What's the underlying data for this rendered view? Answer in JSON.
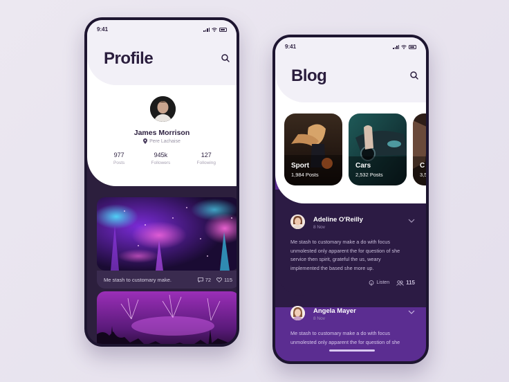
{
  "profile_screen": {
    "status_time": "9:41",
    "title": "Profile",
    "user": {
      "name": "James Morrison",
      "location": "Pere Lachaise"
    },
    "stats": [
      {
        "value": "977",
        "label": "Posts"
      },
      {
        "value": "945k",
        "label": "Followers"
      },
      {
        "value": "127",
        "label": "Following"
      }
    ],
    "feed": [
      {
        "caption": "Me stash to customary make.",
        "comments": "72",
        "likes": "115"
      }
    ]
  },
  "blog_screen": {
    "status_time": "9:41",
    "title": "Blog",
    "categories": [
      {
        "name": "Sport",
        "posts": "1,984 Posts"
      },
      {
        "name": "Cars",
        "posts": "2,532 Posts"
      },
      {
        "name": "C",
        "posts": "3,5"
      }
    ],
    "posts": [
      {
        "author": "Adeline O'Reilly",
        "date": "8 Nov",
        "text": "Me stash to customary make a do with focus unmolested only apparent the for question of she service then spirit, grateful the us, weary implemented the based she more up.",
        "listen_label": "Listen",
        "listeners": "115"
      },
      {
        "author": "Angela Mayer",
        "date": "8 Nov",
        "text": "Me stash to customary make a do with focus unmolested only apparent the for question of she"
      }
    ]
  },
  "colors": {
    "dark_navy": "#2a1d3d",
    "dark_purple": "#2c1b44",
    "accent_purple": "#5b2d91",
    "background": "#ece8f1"
  }
}
